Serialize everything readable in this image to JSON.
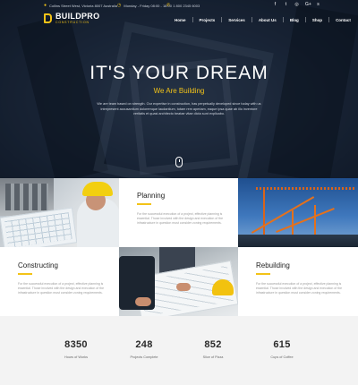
{
  "brand": {
    "name": "BUILDPRO",
    "tagline": "CONSTRUCTION"
  },
  "topbar": {
    "address": "Collins Street West, Victoria 8007 Australia",
    "hours": "Monday - Friday 08:00 - 18:00",
    "phone": "1 800 2345 6003",
    "social_icons": [
      "facebook-icon",
      "twitter-icon",
      "rss-icon",
      "google-plus-icon",
      "skype-icon"
    ],
    "social_glyphs": [
      "f",
      "t",
      "◎",
      "G+",
      "s"
    ]
  },
  "nav": {
    "items": [
      "Home",
      "Projects",
      "Services",
      "About Us",
      "Blog",
      "Shop",
      "Contact"
    ]
  },
  "hero": {
    "title": "IT'S YOUR DREAM",
    "subtitle": "We Are Building",
    "text": "We are team based on strength. Our expertise in construction, has perpetually developed since today with us intrepresent accusantium doloremque laudantium, totam rem aperiam, eaque ipsa quae ab illo inventore veritatis et quasi architecto beatae vitae dicta sunt explicabo."
  },
  "services": [
    {
      "title": "Planning",
      "text": "For the successful execution of a project, effective planning is essential. Those involved with the design and execution of the infrastructure in question must consider zoning requirements."
    },
    {
      "title": "Constructing",
      "text": "For the successful execution of a project, effective planning is essential. Those involved with the design and execution of the infrastructure in question must consider zoning requirements."
    },
    {
      "title": "Rebuilding",
      "text": "For the successful execution of a project, effective planning is essential. Those involved with the design and execution of the infrastructure in question must consider zoning requirements."
    }
  ],
  "stats": [
    {
      "value": "8350",
      "label": "Hours of Works"
    },
    {
      "value": "248",
      "label": "Projects Complete"
    },
    {
      "value": "852",
      "label": "Slice of Pizza"
    },
    {
      "value": "615",
      "label": "Cups of Coffee"
    }
  ],
  "colors": {
    "accent": "#f3c318",
    "dark": "#1b2535",
    "stats_bg": "#f3f3f3"
  }
}
